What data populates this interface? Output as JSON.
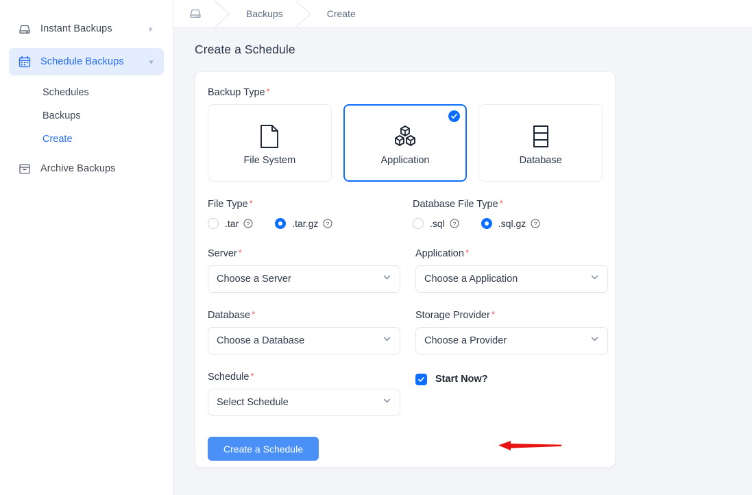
{
  "sidebar": {
    "items": [
      {
        "label": "Instant Backups",
        "icon": "tray-icon",
        "caret": "caret-right",
        "active": false
      },
      {
        "label": "Schedule Backups",
        "icon": "calendar-icon",
        "caret": "caret-down",
        "active": true
      }
    ],
    "sub_items": [
      {
        "label": "Schedules",
        "current": false
      },
      {
        "label": "Backups",
        "current": false
      },
      {
        "label": "Create",
        "current": true
      }
    ],
    "archive": {
      "label": "Archive Backups",
      "icon": "archive-icon"
    }
  },
  "breadcrumb": {
    "home_icon": "tray-icon",
    "items": [
      {
        "label": "Backups"
      },
      {
        "label": "Create"
      }
    ]
  },
  "page": {
    "title": "Create a Schedule"
  },
  "form": {
    "backup_type": {
      "label": "Backup Type",
      "required": "*",
      "options": [
        {
          "label": "File System",
          "icon": "document-icon",
          "selected": false
        },
        {
          "label": "Application",
          "icon": "cubes-icon",
          "selected": true
        },
        {
          "label": "Database",
          "icon": "database-icon",
          "selected": false
        }
      ]
    },
    "file_type": {
      "label": "File Type",
      "required": "*",
      "options": [
        {
          "label": ".tar",
          "selected": false,
          "help": "help-icon"
        },
        {
          "label": ".tar.gz",
          "selected": true,
          "help": "help-icon"
        }
      ]
    },
    "database_file_type": {
      "label": "Database File Type",
      "required": "*",
      "options": [
        {
          "label": ".sql",
          "selected": false,
          "help": "help-icon"
        },
        {
          "label": ".sql.gz",
          "selected": true,
          "help": "help-icon"
        }
      ]
    },
    "server": {
      "label": "Server",
      "required": "*",
      "value": "Choose a Server"
    },
    "application": {
      "label": "Application",
      "required": "*",
      "value": "Choose a Application"
    },
    "database": {
      "label": "Database",
      "required": "*",
      "value": "Choose a Database"
    },
    "storage_provider": {
      "label": "Storage Provider",
      "required": "*",
      "value": "Choose a Provider"
    },
    "schedule": {
      "label": "Schedule",
      "required": "*",
      "value": "Select Schedule"
    },
    "start_now": {
      "label": "Start Now?",
      "checked": true
    },
    "submit_label": "Create a Schedule"
  },
  "annotation": {
    "type": "arrow",
    "color": "#e81313",
    "points_to": "create-a-schedule-button"
  },
  "colors": {
    "accent": "#0d6efd",
    "button": "#4a90f7",
    "sidebar_active_bg": "#e3edfd",
    "required_star": "#fa5a5a",
    "page_bg": "#f4f5f9"
  }
}
